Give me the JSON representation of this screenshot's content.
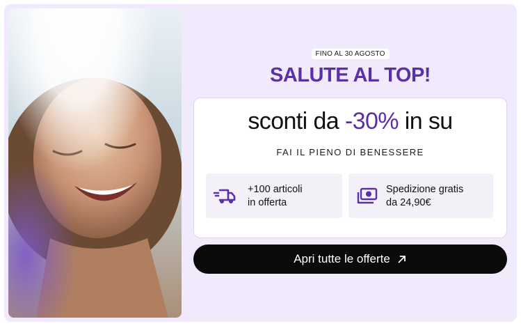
{
  "banner": {
    "date_badge": "FINO AL 30 AGOSTO",
    "headline": "SALUTE AL TOP!"
  },
  "offer": {
    "prefix": "sconti da",
    "highlight": "-30%",
    "suffix": "in su",
    "tagline": "FAI IL PIENO DI BENESSERE"
  },
  "features": [
    {
      "icon": "delivery-truck-icon",
      "line1": "+100 articoli",
      "line2": "in offerta"
    },
    {
      "icon": "banknote-icon",
      "line1": "Spedizione gratis",
      "line2": "da 24,90€"
    }
  ],
  "cta": {
    "label": "Apri tutte le offerte",
    "icon": "arrow-up-right-icon"
  },
  "colors": {
    "accent": "#5a2fa8",
    "background": "#f1eafd",
    "cta_background": "#0b0b0b"
  }
}
